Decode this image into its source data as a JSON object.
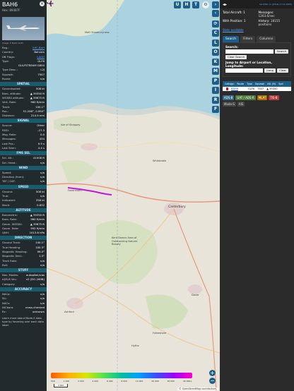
{
  "aircraft": {
    "callsign": "BAH6",
    "hex_line": "Hex: 894B7F",
    "photo_caption": "Image © Bahn both"
  },
  "info": [
    {
      "k": "Reg.:",
      "v": "A9C-BAH",
      "link": true
    },
    {
      "k": "Country:",
      "v": "Bahrain"
    },
    {
      "k": "DB Flags:",
      "v": "LADD",
      "link": true
    },
    {
      "k": "Type:",
      "v": "GLF6"
    },
    {
      "k": "",
      "v": "GULFSTREAM G650"
    },
    {
      "k": "Type Desc.:",
      "v": "L2J"
    },
    {
      "k": "Squawk:",
      "v": "7507"
    },
    {
      "k": "Route:",
      "v": "n/a"
    }
  ],
  "sections": [
    {
      "title": "SPATIAL",
      "rows": [
        {
          "k": "Groundspeed:",
          "v": "508 kt"
        },
        {
          "k": "Baro. altitude:",
          "v": "▲ 39350 ft"
        },
        {
          "k": "WGS84 altitude:",
          "v": "▲ 39675 ft"
        },
        {
          "k": "Vert. Rate:",
          "v": "960 ft/min"
        },
        {
          "k": "Track:",
          "v": "100.1°"
        },
        {
          "k": "Pos.:",
          "v": "51.298°, 0.950°"
        },
        {
          "k": "Distance:",
          "v": "214.9 nmi"
        }
      ]
    },
    {
      "title": "SIGNAL",
      "rows": [
        {
          "k": "Source:",
          "v": "Other"
        },
        {
          "k": "RSSI:",
          "v": "-27.3"
        },
        {
          "k": "Msg. Rate:",
          "v": "0.0"
        },
        {
          "k": "Messages:",
          "v": "434"
        },
        {
          "k": "Last Pos.:",
          "v": "9.9 s"
        },
        {
          "k": "Last Seen:",
          "v": "4.4 s"
        }
      ]
    },
    {
      "title": "FMS SEL",
      "rows": [
        {
          "k": "Sel. Alt.:",
          "v": "41008 ft"
        },
        {
          "k": "Sel. Head.:",
          "v": "n/a"
        }
      ]
    },
    {
      "title": "WIND",
      "rows": [
        {
          "k": "Speed:",
          "v": "n/a"
        },
        {
          "k": "Direction (from):",
          "v": "n/a"
        },
        {
          "k": "TAT / OAT:",
          "v": "n/a"
        }
      ]
    },
    {
      "title": "SPEED",
      "rows": [
        {
          "k": "Ground:",
          "v": "508 kt"
        },
        {
          "k": "True:",
          "v": "n/a"
        },
        {
          "k": "Indicated:",
          "v": "258 kt"
        },
        {
          "k": "Mach:",
          "v": "0.832"
        }
      ]
    },
    {
      "title": "ALTITUDE",
      "rows": [
        {
          "k": "Barometric:",
          "v": "▲ 39350 ft"
        },
        {
          "k": "Baro. Rate:",
          "v": "960 ft/min"
        },
        {
          "k": "Geom. WGS84:",
          "v": "▲ 39675 ft"
        },
        {
          "k": "Geom. Rate:",
          "v": "992 ft/min"
        },
        {
          "k": "QNH:",
          "v": "1013.6 hPa"
        }
      ]
    },
    {
      "title": "DIRECTION",
      "rows": [
        {
          "k": "Ground Track:",
          "v": "100.1°"
        },
        {
          "k": "True Heading:",
          "v": "100.3°"
        },
        {
          "k": "Magnetic Heading:",
          "v": "99.0°"
        },
        {
          "k": "Magnetic Decl.:",
          "v": "1.3°"
        },
        {
          "k": "Track Rate:",
          "v": "n/a"
        },
        {
          "k": "Roll:",
          "v": "n/a"
        }
      ]
    },
    {
      "title": "STUFF",
      "rows": [
        {
          "k": "Nav. Modes:",
          "v": "autopilot,tcas"
        },
        {
          "k": "ADS-B Ver.:",
          "v": "v2 (DO-260B)"
        },
        {
          "k": "Category:",
          "v": "n/a"
        }
      ]
    },
    {
      "title": "ACCURACY",
      "rows": [
        {
          "k": "NACp:",
          "v": "n/a"
        },
        {
          "k": "SIL:",
          "v": "n/a"
        },
        {
          "k": "NACv:",
          "v": "n/a"
        },
        {
          "k": "NICbaro:",
          "v": "cross-checked"
        },
        {
          "k": "Rc:",
          "v": "unknown"
        }
      ]
    }
  ],
  "left_footer": "Learn more about Mode-S data type by hovering over each data label.",
  "map": {
    "top_buttons": [
      "U",
      "H",
      "T"
    ],
    "labels": [
      {
        "t": "MoD Shoeburyness",
        "big": false
      },
      {
        "t": "Isle of Sheppey",
        "big": false
      },
      {
        "t": "Whitstable",
        "big": false
      },
      {
        "t": "Canterbury",
        "big": true
      },
      {
        "t": "Faversham",
        "big": false
      },
      {
        "t": "Kent Downs Area of Outstanding Natural Beauty",
        "big": false
      },
      {
        "t": "Dover",
        "big": false
      },
      {
        "t": "Folkestone",
        "big": false
      },
      {
        "t": "Ashford",
        "big": false
      },
      {
        "t": "Hythe",
        "big": false
      }
    ],
    "legend_ticks": [
      "500",
      "1 000",
      "2 000",
      "4 000",
      "6 000",
      "8 000",
      "10 000",
      "20 000",
      "30 000",
      "40 000+"
    ],
    "scale": "2 NM",
    "attribution": "© OpenStreetMap contributors."
  },
  "side_buttons": [
    "C",
    "L",
    "O",
    "K",
    "M",
    "P",
    "I",
    "R",
    "F"
  ],
  "right": {
    "version": "tar1090 on github (3.14.1605)",
    "stats": {
      "total_label": "Total Aircraft: 1",
      "messages_label": "Messages:",
      "messages_value": "1263.6/sec",
      "withpos_label": "With Position: 1",
      "history_label": "History:",
      "history_value": "18155 positions"
    },
    "stats_link": "Stats available",
    "tabs": [
      "Search",
      "Filters",
      "Columns"
    ],
    "search_label": "Search:",
    "search_button": "Search",
    "clear_search": "Clear Search",
    "jump_label": "Jump to Airport or Location, Longitude:",
    "jump_button": "Jump",
    "clear_button": "Clear",
    "table_headers": [
      "Callsign",
      "Route",
      "Type",
      "Squawk",
      "Alt. (ft)",
      "Spd"
    ],
    "table_row": {
      "callsign": "BAH6",
      "type": "GLF6",
      "squawk": "7507",
      "alt": "▲ 39350"
    },
    "badges": [
      "ADS-B",
      "UAT / ADS-R",
      "MLAT",
      "TIS-B",
      "Mode-S",
      "AIS"
    ]
  },
  "colors": {
    "panel": "#232a2e",
    "section": "#1b5b6e",
    "accent": "#1e5f8a",
    "trail": "#c218d6",
    "map_bg": "#dcd7cf"
  }
}
